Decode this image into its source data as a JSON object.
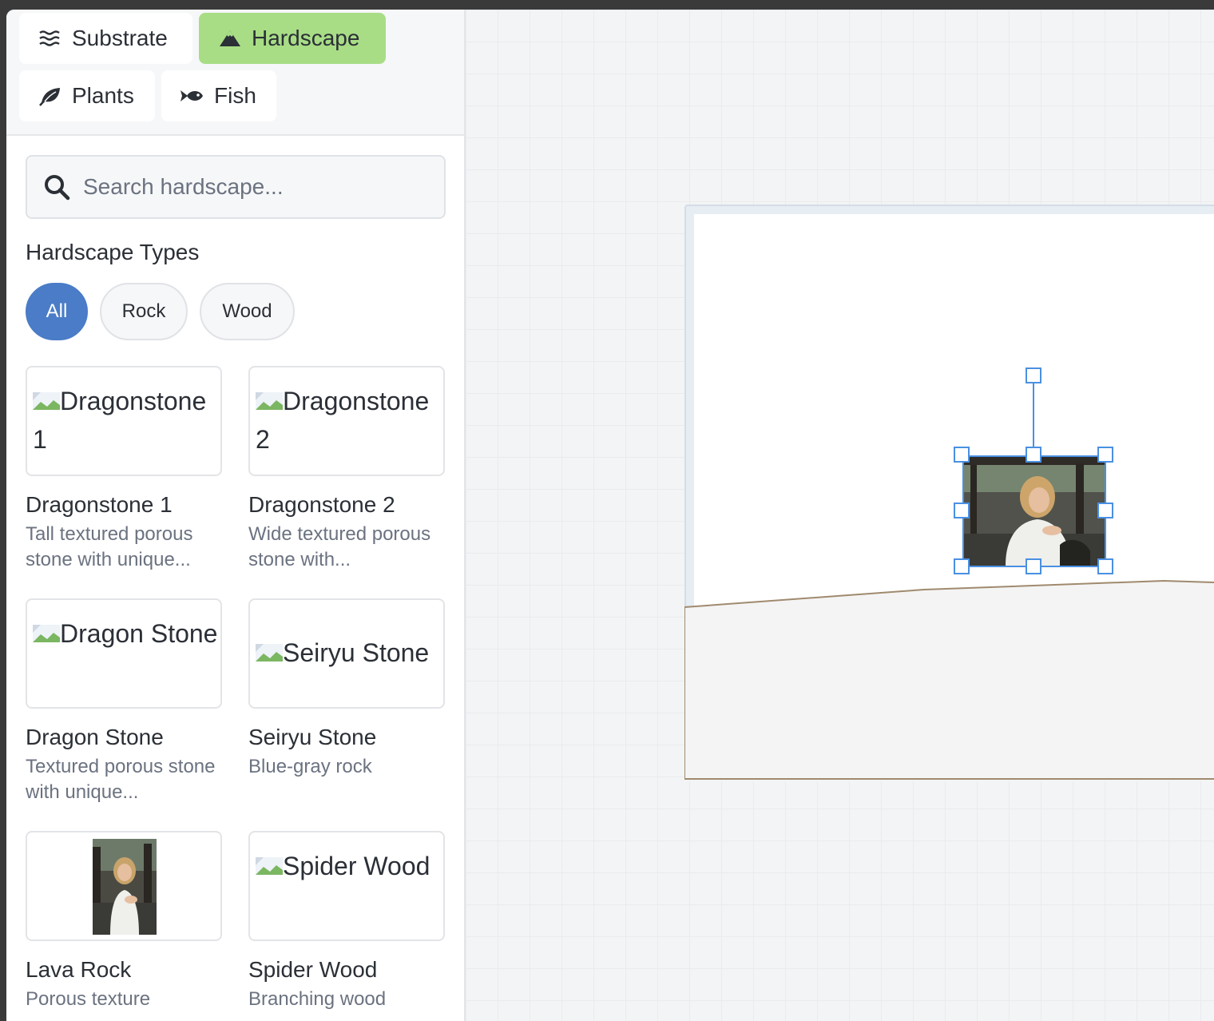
{
  "tabs": [
    {
      "label": "Substrate",
      "icon": "waves-icon",
      "active": false
    },
    {
      "label": "Hardscape",
      "icon": "mountain-icon",
      "active": true
    },
    {
      "label": "Plants",
      "icon": "leaf-icon",
      "active": false
    },
    {
      "label": "Fish",
      "icon": "fish-icon",
      "active": false
    }
  ],
  "search": {
    "placeholder": "Search hardscape...",
    "value": ""
  },
  "types": {
    "title": "Hardscape Types",
    "filters": [
      {
        "label": "All",
        "active": true
      },
      {
        "label": "Rock",
        "active": false
      },
      {
        "label": "Wood",
        "active": false
      }
    ]
  },
  "items": [
    {
      "name": "Dragonstone 1",
      "alt": "Dragonstone 1",
      "desc": "Tall textured porous stone with unique..."
    },
    {
      "name": "Dragonstone 2",
      "alt": "Dragonstone 2",
      "desc": "Wide textured porous stone with..."
    },
    {
      "name": "Dragon Stone",
      "alt": "Dragon Stone",
      "desc": "Textured porous stone with unique..."
    },
    {
      "name": "Seiryu Stone",
      "alt": "Seiryu Stone",
      "desc": "Blue-gray rock"
    },
    {
      "name": "Lava Rock",
      "alt": "",
      "desc": "Porous texture"
    },
    {
      "name": "Spider Wood",
      "alt": "Spider Wood",
      "desc": "Branching wood"
    }
  ],
  "colors": {
    "active_tab": "#a8dd86",
    "active_filter": "#4a7cc7",
    "selection": "#4a90e2",
    "substrate_line": "#a08a6e"
  }
}
